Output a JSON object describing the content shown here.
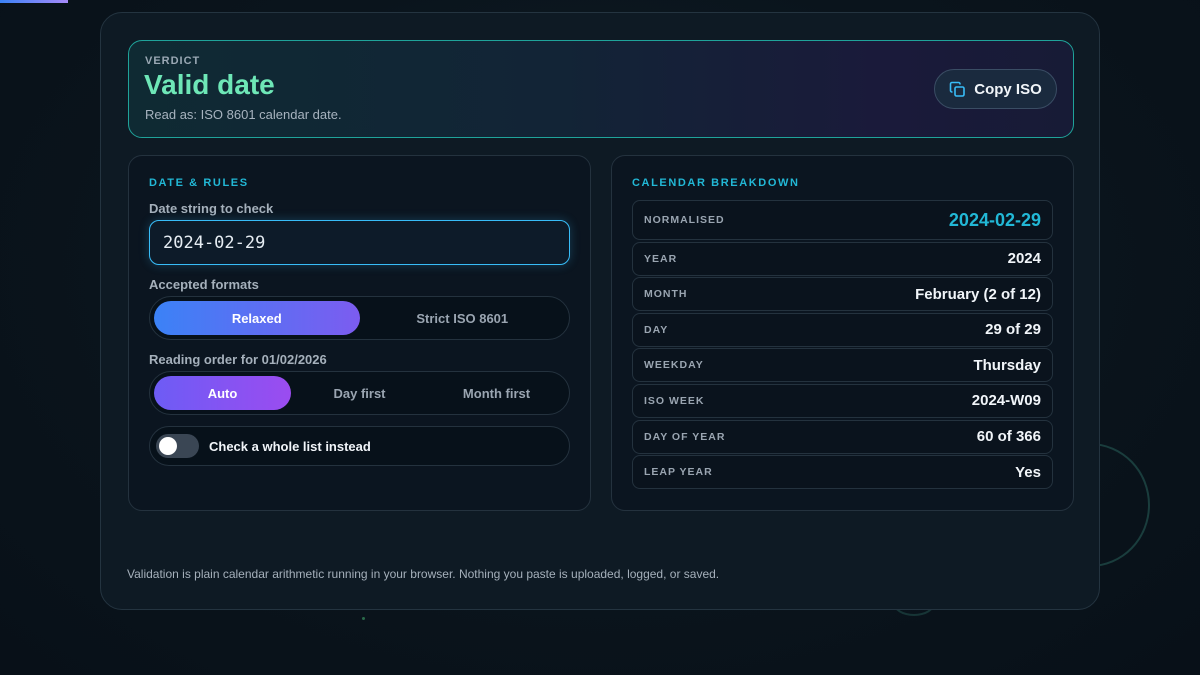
{
  "verdict": {
    "kicker": "VERDICT",
    "title": "Valid date",
    "subtitle": "Read as: ISO 8601 calendar date.",
    "copy_button": "Copy ISO"
  },
  "rules": {
    "title": "DATE & RULES",
    "date_label": "Date string to check",
    "date_value": "2024-02-29",
    "formats_label": "Accepted formats",
    "formats": [
      "Relaxed",
      "Strict ISO 8601"
    ],
    "formats_selected": "Relaxed",
    "order_label": "Reading order for 01/02/2026",
    "orders": [
      "Auto",
      "Day first",
      "Month first"
    ],
    "order_selected": "Auto",
    "toggle_label": "Check a whole list instead",
    "toggle_on": false
  },
  "breakdown": {
    "title": "CALENDAR BREAKDOWN",
    "rows": [
      {
        "label": "NORMALISED",
        "value": "2024-02-29"
      },
      {
        "label": "YEAR",
        "value": "2024"
      },
      {
        "label": "MONTH",
        "value": "February (2 of 12)"
      },
      {
        "label": "DAY",
        "value": "29 of 29"
      },
      {
        "label": "WEEKDAY",
        "value": "Thursday"
      },
      {
        "label": "ISO WEEK",
        "value": "2024-W09"
      },
      {
        "label": "DAY OF YEAR",
        "value": "60 of 366"
      },
      {
        "label": "LEAP YEAR",
        "value": "Yes"
      }
    ]
  },
  "footer": "Validation is plain calendar arithmetic running in your browser. Nothing you paste is uploaded, logged, or saved.",
  "colors": {
    "accent_cyan": "#22b8d6",
    "valid_green": "#6ee7b7",
    "active_blue": "#3b82f6",
    "active_purple": "#9b4cf0"
  }
}
